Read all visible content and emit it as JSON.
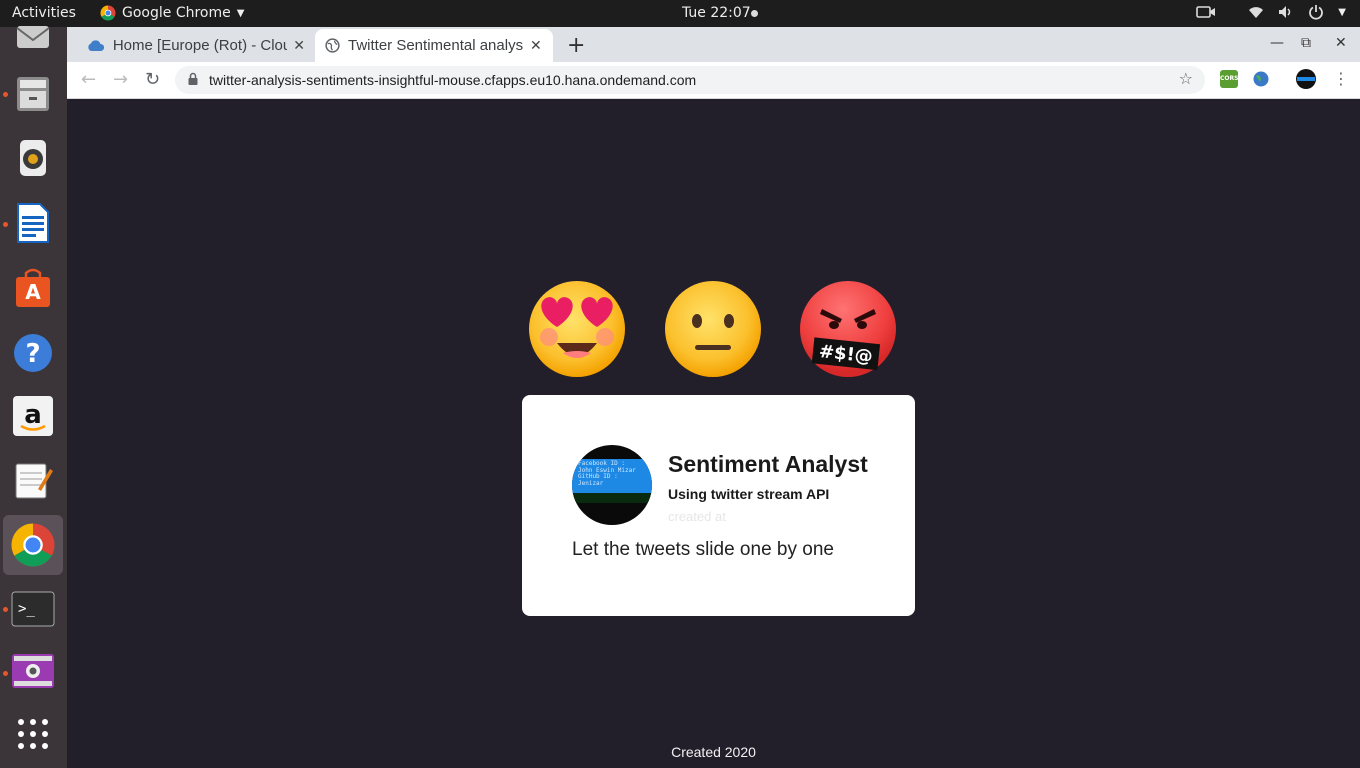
{
  "topbar": {
    "activities": "Activities",
    "app_name": "Google Chrome",
    "clock": "Tue 22:07"
  },
  "dock": {
    "items": [
      "mail",
      "files",
      "rhythmbox",
      "libreoffice-writer",
      "software-center",
      "help",
      "amazon",
      "text-editor",
      "chrome",
      "terminal",
      "screen-recorder",
      "app-grid"
    ]
  },
  "browser": {
    "tabs": [
      {
        "title": "Home [Europe (Rot) - Cloud"
      },
      {
        "title": "Twitter Sentimental analysis"
      }
    ],
    "url": "twitter-analysis-sentiments-insightful-mouse.cfapps.eu10.hana.ondemand.com",
    "extensions": [
      {
        "label": "CORS"
      }
    ]
  },
  "page": {
    "card": {
      "title": "Sentiment Analyst",
      "subtitle": "Using twitter stream API",
      "created": "created at",
      "text": "Let the tweets slide one by one",
      "avatar_lines": [
        "Facebook ID :",
        "John Eswin Mizar",
        "GitHub ID :",
        "Jenizar"
      ]
    },
    "emoji_overlay": "#$!@",
    "footer": "Created 2020"
  }
}
